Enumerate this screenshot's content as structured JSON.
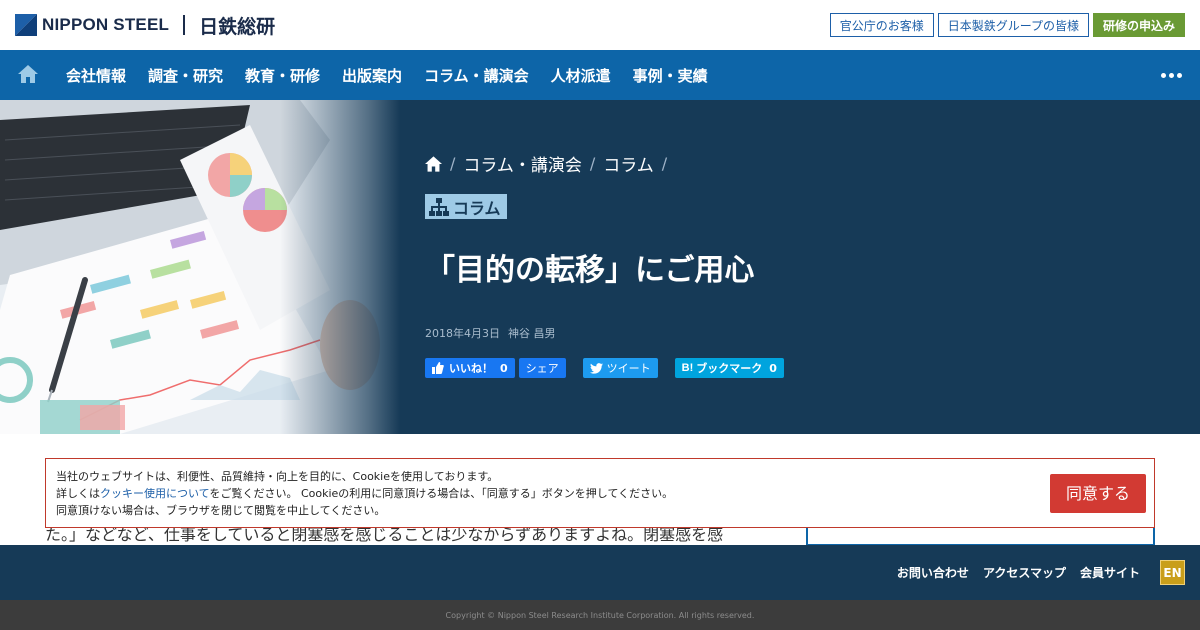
{
  "header": {
    "logo_text": "NIPPON STEEL",
    "logo_jp": "日鉄総研",
    "links": [
      "官公庁のお客様",
      "日本製鉄グループの皆様"
    ],
    "apply_label": "研修の申込み"
  },
  "nav": {
    "items": [
      "会社情報",
      "調査・研究",
      "教育・研修",
      "出版案内",
      "コラム・講演会",
      "人材派遣",
      "事例・実績"
    ]
  },
  "hero": {
    "breadcrumb": [
      "コラム・講演会",
      "コラム"
    ],
    "tag": "コラム",
    "title": "「目的の転移」にご用心",
    "date": "2018年4月3日",
    "author": "神谷 昌男",
    "social": {
      "like_label": "いいね！",
      "like_count": "0",
      "share_label": "シェア",
      "tweet_label": "ツイート",
      "bookmark_label": "ブックマーク",
      "bookmark_count": "0"
    }
  },
  "article": {
    "partial_line": "た。」などなど、仕事をしていると閉塞感を感じることは少なからずありますよね。閉塞感を感"
  },
  "cookie": {
    "line1": "当社のウェブサイトは、利便性、品質維持・向上を目的に、Cookieを使用しております。",
    "line2_pre": "詳しくは",
    "line2_link": "クッキー使用について",
    "line2_post": "をご覧ください。 Cookieの利用に同意頂ける場合は、「同意する」ボタンを押してください。",
    "line3": "同意頂けない場合は、ブラウザを閉じて閲覧を中止してください。",
    "agree_label": "同意する"
  },
  "footer": {
    "links": [
      "お問い合わせ",
      "アクセスマップ",
      "会員サイト"
    ],
    "lang": "EN",
    "copyright": "Copyright © Nippon Steel Research Institute Corporation. All rights reserved."
  },
  "colors": {
    "nav": "#0d65a8",
    "hero": "#163a57",
    "apply": "#6a9a34",
    "agree": "#d23a33",
    "en": "#c99e1a"
  }
}
